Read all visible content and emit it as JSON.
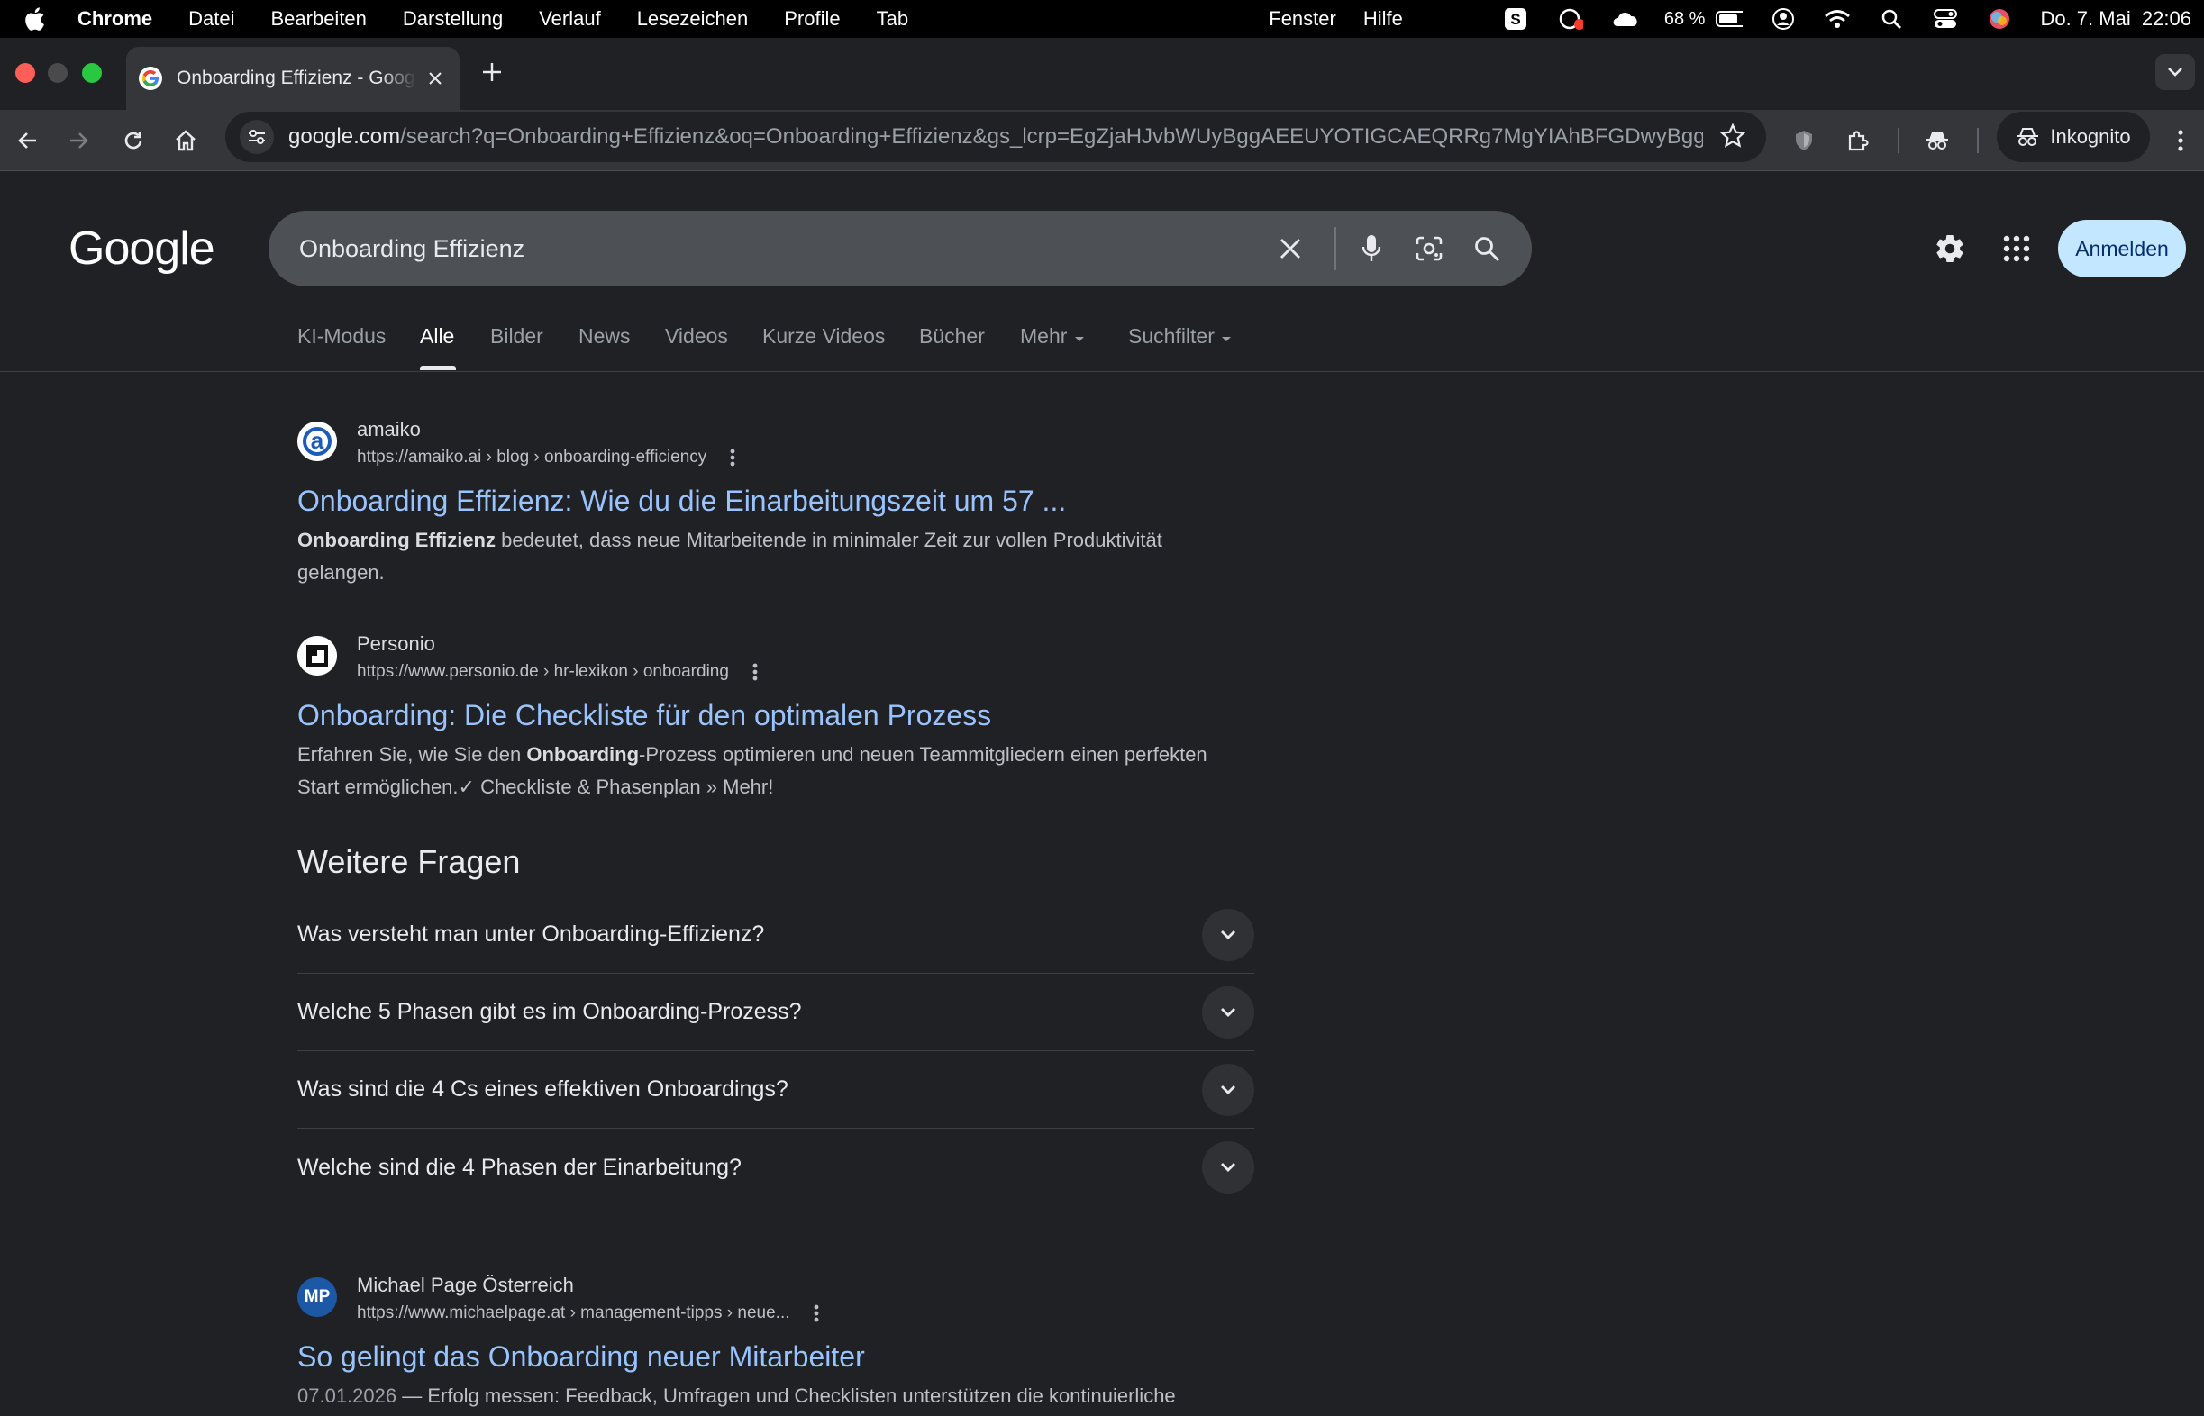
{
  "menubar": {
    "app": "Chrome",
    "items": [
      "Datei",
      "Bearbeiten",
      "Darstellung",
      "Verlauf",
      "Lesezeichen",
      "Profile",
      "Tab"
    ],
    "right_items": [
      "Fenster",
      "Hilfe"
    ],
    "battery": "68 %",
    "datetime": "Do. 7. Mai  22:06"
  },
  "browser": {
    "tab_title": "Onboarding Effizienz - Google Suche",
    "url_host": "google.com",
    "url_path": "/search?q=Onboarding+Effizienz&oq=Onboarding+Effizienz&gs_lcrp=EgZjaHJvbWUyBggAEEUYOTIGCAEQRRg7MgYIAhBFGDwyBgg...",
    "incognito_label": "Inkognito"
  },
  "google": {
    "logo": "Google",
    "query": "Onboarding Effizienz",
    "signin_label": "Anmelden",
    "tabs": [
      "KI-Modus",
      "Alle",
      "Bilder",
      "News",
      "Videos",
      "Kurze Videos",
      "Bücher",
      "Mehr",
      "Suchfilter"
    ],
    "active_tab": "Alle"
  },
  "results": [
    {
      "site": "amaiko",
      "url": "https://amaiko.ai › blog › onboarding-efficiency",
      "title": "Onboarding Effizienz: Wie du die Einarbeitungszeit um 57 ...",
      "snippet_bold": "Onboarding Effizienz",
      "snippet_rest": " bedeutet, dass neue Mitarbeitende in minimaler Zeit zur vollen Produktivität gelangen."
    },
    {
      "site": "Personio",
      "url": "https://www.personio.de › hr-lexikon › onboarding",
      "title": "Onboarding: Die Checkliste für den optimalen Prozess",
      "snippet_pre": "Erfahren Sie, wie Sie den ",
      "snippet_bold": "Onboarding",
      "snippet_rest": "-Prozess optimieren und neuen Teammitgliedern einen perfekten Start ermöglichen.✓ Checkliste & Phasenplan » Mehr!"
    },
    {
      "site": "Michael Page Österreich",
      "favicon_text": "MP",
      "url": "https://www.michaelpage.at › management-tipps › neue...",
      "title": "So gelingt das Onboarding neuer Mitarbeiter",
      "date": "07.01.2026",
      "snippet_rest": " — Erfolg messen: Feedback, Umfragen und Checklisten unterstützen die kontinuierliche"
    }
  ],
  "paa": {
    "title": "Weitere Fragen",
    "questions": [
      "Was versteht man unter Onboarding-Effizienz?",
      "Welche 5 Phasen gibt es im Onboarding-Prozess?",
      "Was sind die 4 Cs eines effektiven Onboardings?",
      "Welche sind die 4 Phasen der Einarbeitung?"
    ]
  }
}
